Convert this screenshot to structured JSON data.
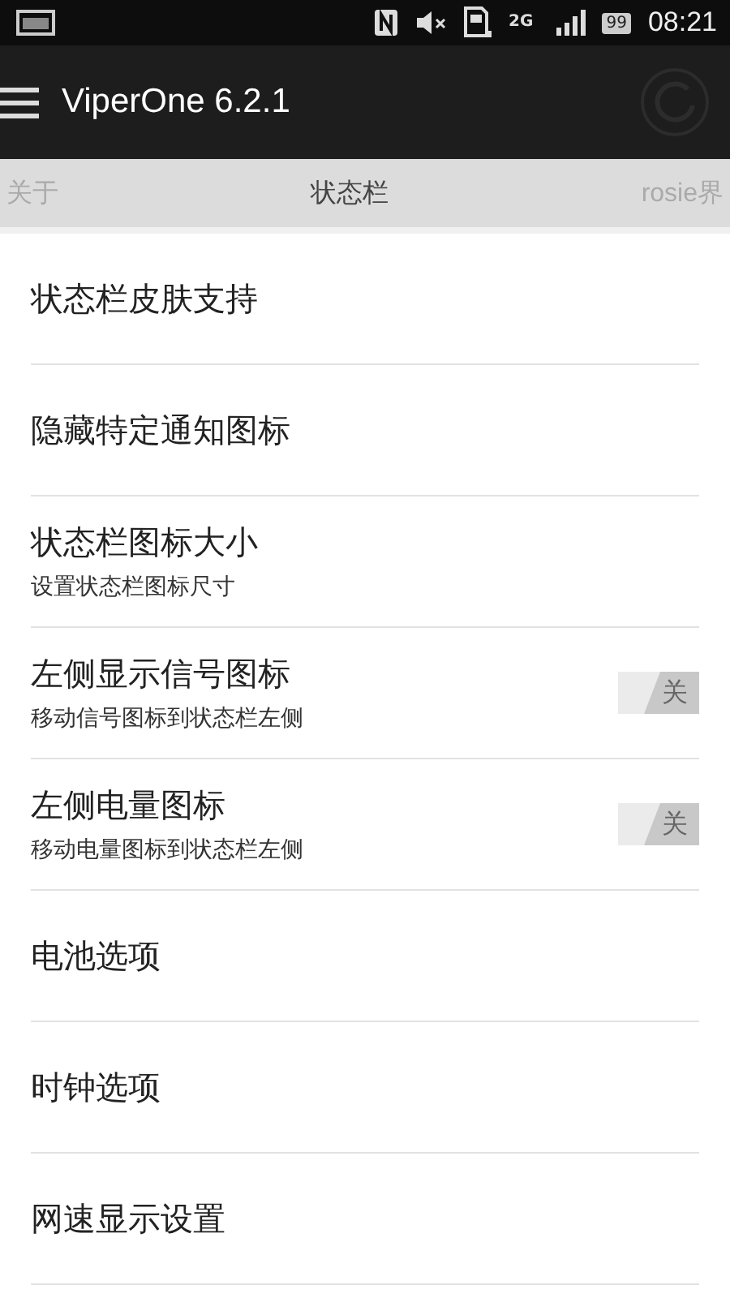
{
  "status_bar": {
    "network": "2G",
    "battery": "99",
    "time": "08:21"
  },
  "action_bar": {
    "title": "ViperOne 6.2.1"
  },
  "tabs": [
    {
      "label": "关于",
      "selected": false
    },
    {
      "label": "状态栏",
      "selected": true
    },
    {
      "label": "rosie界",
      "selected": false
    }
  ],
  "settings": [
    {
      "kind": "plain",
      "title": "状态栏皮肤支持"
    },
    {
      "kind": "plain",
      "title": "隐藏特定通知图标"
    },
    {
      "kind": "plain",
      "title": "状态栏图标大小",
      "summary": "设置状态栏图标尺寸"
    },
    {
      "kind": "switch",
      "title": "左侧显示信号图标",
      "summary": "移动信号图标到状态栏左侧",
      "on": false,
      "switch_label": "关"
    },
    {
      "kind": "switch",
      "title": "左侧电量图标",
      "summary": "移动电量图标到状态栏左侧",
      "on": false,
      "switch_label": "关"
    },
    {
      "kind": "plain",
      "title": "电池选项"
    },
    {
      "kind": "plain",
      "title": "时钟选项"
    },
    {
      "kind": "plain",
      "title": "网速显示设置"
    }
  ]
}
